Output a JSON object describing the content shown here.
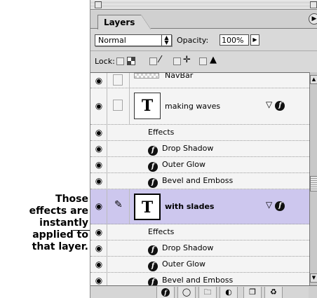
{
  "caption": {
    "lines": [
      "Those",
      "effects are",
      "instantly",
      "applied to",
      "that layer."
    ]
  },
  "panel": {
    "tab_label": "Layers",
    "blend_mode": "Normal",
    "opacity_label": "Opacity:",
    "opacity_value": "100%",
    "lock_label": "Lock:"
  },
  "layers": {
    "navbar_name": "NavBar",
    "layer1": {
      "name": "making waves",
      "effects_label": "Effects",
      "effects": [
        "Drop Shadow",
        "Outer Glow",
        "Bevel and Emboss"
      ]
    },
    "layer2": {
      "name": "with slades",
      "effects_label": "Effects",
      "effects": [
        "Drop Shadow",
        "Outer Glow",
        "Bevel and Emboss"
      ]
    }
  },
  "icons": {
    "eye": "eye-icon",
    "brush": "brush-icon",
    "effect": "effect-icon",
    "thumbnail_glyph": "T"
  },
  "colors": {
    "selected_row": "#cdc7ee",
    "panel_bg": "#d9d9d9"
  }
}
